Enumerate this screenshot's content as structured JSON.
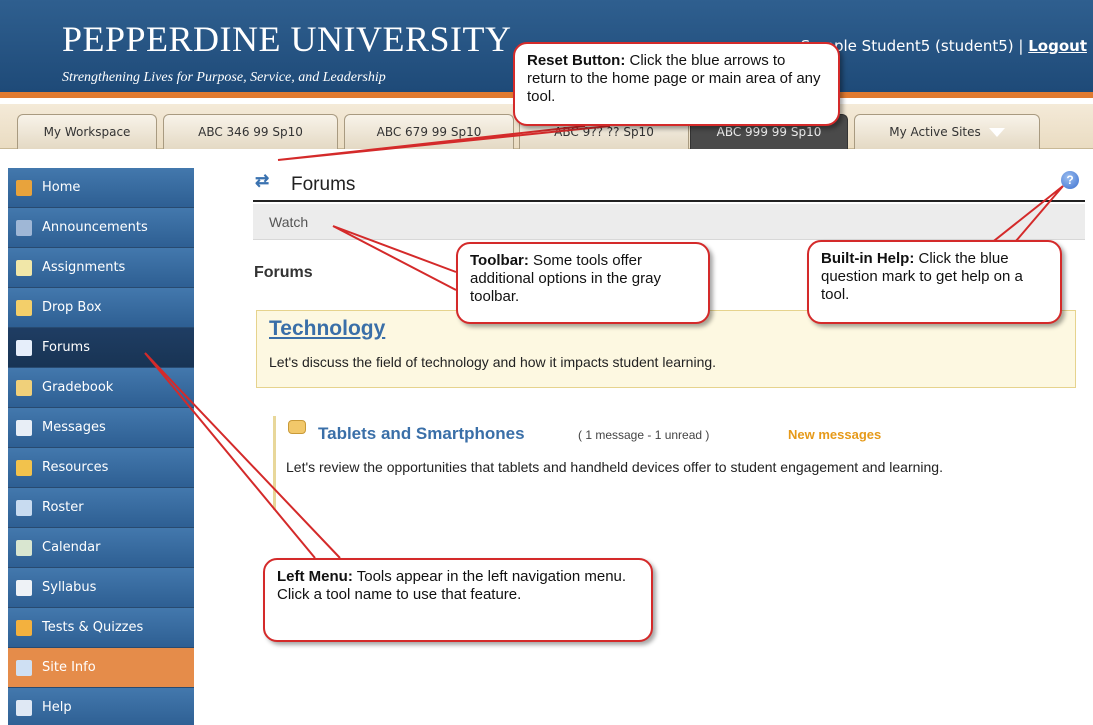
{
  "header": {
    "university_name": "PEPPERDINE UNIVERSITY",
    "tagline": "Strengthening Lives for Purpose, Service, and Leadership",
    "user_text": "Sample Student5 (student5) | ",
    "logout_label": "Logout"
  },
  "tabs": [
    {
      "label": "My Workspace"
    },
    {
      "label": "ABC 346 99 Sp10"
    },
    {
      "label": "ABC 679 99 Sp10"
    },
    {
      "label": "ABC 9?? ?? Sp10"
    },
    {
      "label": "ABC 999 99 Sp10"
    },
    {
      "label": "My Active Sites"
    }
  ],
  "menu": [
    {
      "label": "Home",
      "icon": "home-icon",
      "icon_color": "#e8a33c"
    },
    {
      "label": "Announcements",
      "icon": "megaphone-icon",
      "icon_color": "#9fb7d6"
    },
    {
      "label": "Assignments",
      "icon": "pencil-paper-icon",
      "icon_color": "#f1e7a8"
    },
    {
      "label": "Drop Box",
      "icon": "dropbox-icon",
      "icon_color": "#f3cf6a"
    },
    {
      "label": "Forums",
      "icon": "chat-bubbles-icon",
      "icon_color": "#e6eefa"
    },
    {
      "label": "Gradebook",
      "icon": "gradebook-icon",
      "icon_color": "#f0d07a"
    },
    {
      "label": "Messages",
      "icon": "speech-bubble-icon",
      "icon_color": "#e8eef6"
    },
    {
      "label": "Resources",
      "icon": "folder-icon",
      "icon_color": "#f2c24c"
    },
    {
      "label": "Roster",
      "icon": "roster-card-icon",
      "icon_color": "#c8dbf0"
    },
    {
      "label": "Calendar",
      "icon": "calendar-icon",
      "icon_color": "#d9e6d0"
    },
    {
      "label": "Syllabus",
      "icon": "syllabus-icon",
      "icon_color": "#eef2f6"
    },
    {
      "label": "Tests & Quizzes",
      "icon": "pencil-icon",
      "icon_color": "#f3b13e"
    },
    {
      "label": "Site Info",
      "icon": "site-info-icon",
      "icon_color": "#cfe0f3"
    },
    {
      "label": "Help",
      "icon": "help-circle-icon",
      "icon_color": "#dfe8f4"
    }
  ],
  "content": {
    "tool_title": "Forums",
    "toolbar_watch": "Watch",
    "forums_heading": "Forums",
    "forum": {
      "name": "Technology",
      "description": "Let's discuss the field of technology and how it impacts student learning."
    },
    "topic": {
      "title": "Tablets and Smartphones",
      "count": "( 1 message - 1 unread )",
      "new_label": "New messages",
      "description": "Let's review the opportunities that tablets and handheld devices offer to student engagement and learning."
    }
  },
  "callouts": {
    "reset": {
      "bold": "Reset Button:",
      "text": " Click the blue arrows to return to the home page or main area of any tool."
    },
    "toolbar": {
      "bold": "Toolbar:",
      "text": " Some tools offer additional options in the gray toolbar."
    },
    "help": {
      "bold": "Built-in Help:",
      "text": " Click the blue question mark to get help on a tool."
    },
    "leftmenu": {
      "bold": "Left Menu:",
      "text": " Tools appear in the left navigation menu. Click a tool name to use that feature."
    }
  },
  "colors": {
    "header_blue": "#2a5a8c",
    "accent_orange": "#e07a30",
    "menu_blue": "#3a6ea3",
    "menu_selected": "#1e3d62",
    "link_blue": "#3a6fa8",
    "callout_red": "#d42a2a"
  }
}
